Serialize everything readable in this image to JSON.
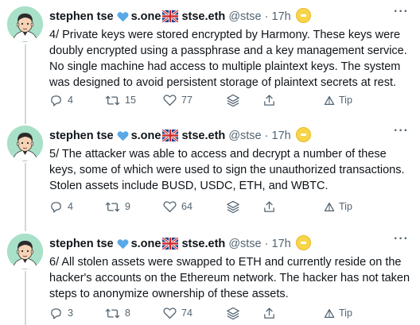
{
  "tweets": [
    {
      "author_name": "stephen tse",
      "account": "s.one",
      "ens": "stse.eth",
      "handle": "@stse",
      "separator": "·",
      "time": "17h",
      "text": "4/ Private keys were stored encrypted by Harmony. These keys were doubly encrypted using a passphrase and a key management service. No single machine had access to multiple plaintext keys. The system was designed to avoid persistent storage of plaintext secrets at rest.",
      "replies": "4",
      "retweets": "15",
      "likes": "77",
      "tip": "Tip"
    },
    {
      "author_name": "stephen tse",
      "account": "s.one",
      "ens": "stse.eth",
      "handle": "@stse",
      "separator": "·",
      "time": "17h",
      "text": "5/ The attacker was able to access and decrypt a number of these keys, some of which were used to sign the unauthorized transactions. Stolen assets include BUSD, USDC, ETH, and WBTC.",
      "replies": "4",
      "retweets": "9",
      "likes": "64",
      "tip": "Tip"
    },
    {
      "author_name": "stephen tse",
      "account": "s.one",
      "ens": "stse.eth",
      "handle": "@stse",
      "separator": "·",
      "time": "17h",
      "text": "6/ All stolen assets were swapped to ETH and currently reside on the hacker's accounts on the Ethereum network. The hacker has not taken steps to anonymize ownership of these assets.",
      "replies": "3",
      "retweets": "8",
      "likes": "74",
      "tip": "Tip"
    }
  ],
  "colors": {
    "text": "#0f1419",
    "secondary": "#536471",
    "heart": "#5aa9e6",
    "thread_line": "#cfd9de",
    "avatar_bg": "#a8e0c8",
    "coin": "#f7d54a"
  },
  "icons": [
    "blue-heart-icon",
    "uk-flag-icon",
    "gold-coin-icon",
    "more-icon",
    "reply-icon",
    "retweet-icon",
    "like-icon",
    "stack-icon",
    "share-icon",
    "tip-icon"
  ]
}
